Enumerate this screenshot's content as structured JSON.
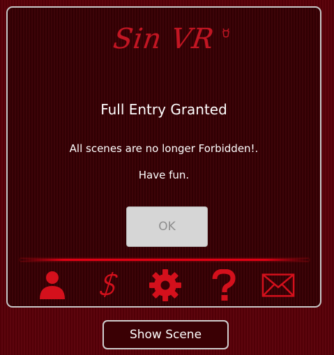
{
  "app": {
    "logo_text": "Sin VR"
  },
  "dialog": {
    "title": "Full Entry Granted",
    "message_line1": "All scenes are no longer Forbidden!.",
    "message_line2": "Have fun.",
    "ok_label": "OK"
  },
  "toolbar": {
    "icons": [
      "user-icon",
      "dollar-icon",
      "gear-icon",
      "help-icon",
      "mail-icon"
    ]
  },
  "footer": {
    "show_scene_label": "Show Scene"
  },
  "colors": {
    "accent": "#d4101c",
    "background": "#3a0004",
    "border": "#c9c9c9",
    "button_bg": "#d6d6d6",
    "button_text": "#8e8e8e"
  }
}
